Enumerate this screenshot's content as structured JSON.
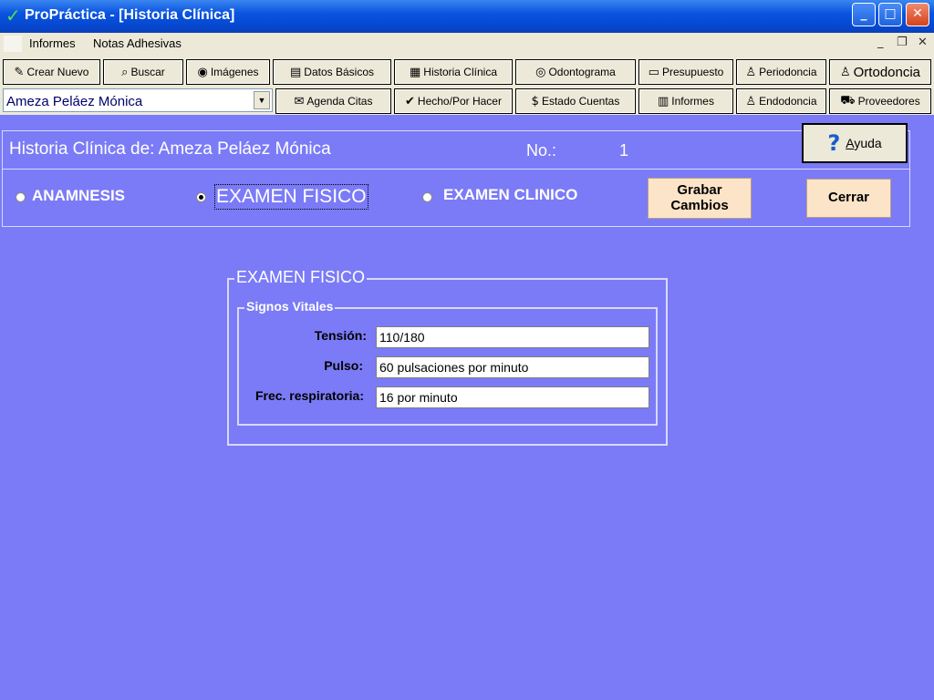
{
  "window": {
    "title": "ProPráctica - [Historia Clínica]",
    "check_glyph": "✓",
    "controls": {
      "minimize": "_",
      "maximize": "□",
      "close": "✕"
    }
  },
  "menu": {
    "items": [
      "Informes",
      "Notas Adhesivas"
    ],
    "mdi_controls": {
      "minimize": "_",
      "restore": "❐",
      "close": "✕"
    }
  },
  "toolbar": {
    "buttons": {
      "crear_nuevo": "Crear Nuevo",
      "buscar": "Buscar",
      "imagenes": "Imágenes",
      "datos_basicos": "Datos Básicos",
      "historia_clinica": "Historia Clínica",
      "odontograma": "Odontograma",
      "presupuesto": "Presupuesto",
      "periodoncia": "Periodoncia",
      "ortodoncia": "Ortodoncia",
      "agenda_citas": "Agenda Citas",
      "hecho_por_hacer": "Hecho/Por Hacer",
      "estado_cuentas": "Estado Cuentas",
      "informes": "Informes",
      "endodoncia": "Endodoncia",
      "proveedores": "Proveedores"
    },
    "icons": {
      "crear_nuevo": "✎",
      "buscar": "⌕",
      "imagenes": "◉",
      "datos_basicos": "▤",
      "historia_clinica": "▦",
      "odontograma": "◎",
      "presupuesto": "▭",
      "periodoncia": "♙",
      "ortodoncia": "♙",
      "agenda_citas": "✉",
      "hecho_por_hacer": "✔",
      "estado_cuentas": "$",
      "informes": "▥",
      "endodoncia": "♙",
      "proveedores": "⛟"
    }
  },
  "patient_selector": {
    "value": "Ameza Peláez Mónica",
    "arrow": "▼"
  },
  "historia": {
    "title": "Historia Clínica de: Ameza Peláez Mónica",
    "no_label": "No.:",
    "no_value": "1",
    "tabs": [
      {
        "label": "ANAMNESIS",
        "checked": false
      },
      {
        "label": "EXAMEN FISICO",
        "checked": true
      },
      {
        "label": "EXAMEN CLINICO",
        "checked": false
      }
    ],
    "grabar_line1": "Grabar",
    "grabar_line2": "Cambios",
    "cerrar": "Cerrar",
    "ayuda_q": "?",
    "ayuda_first": "A",
    "ayuda_rest": "yuda"
  },
  "examen_fisico": {
    "legend": "EXAMEN FISICO",
    "signos_vitales": {
      "legend": "Signos Vitales",
      "fields": [
        {
          "label": "Tensión:",
          "value": "110/180"
        },
        {
          "label": "Pulso:",
          "value": "60 pulsaciones por minuto"
        },
        {
          "label": "Frec. respiratoria:",
          "value": "16 por minuto"
        }
      ]
    }
  },
  "colors": {
    "background": "#7b7bf7",
    "titlebar": "#0a54e0",
    "toolbar": "#ece9d8",
    "button_tan": "#fce4c8",
    "patient_text": "#00006b"
  }
}
